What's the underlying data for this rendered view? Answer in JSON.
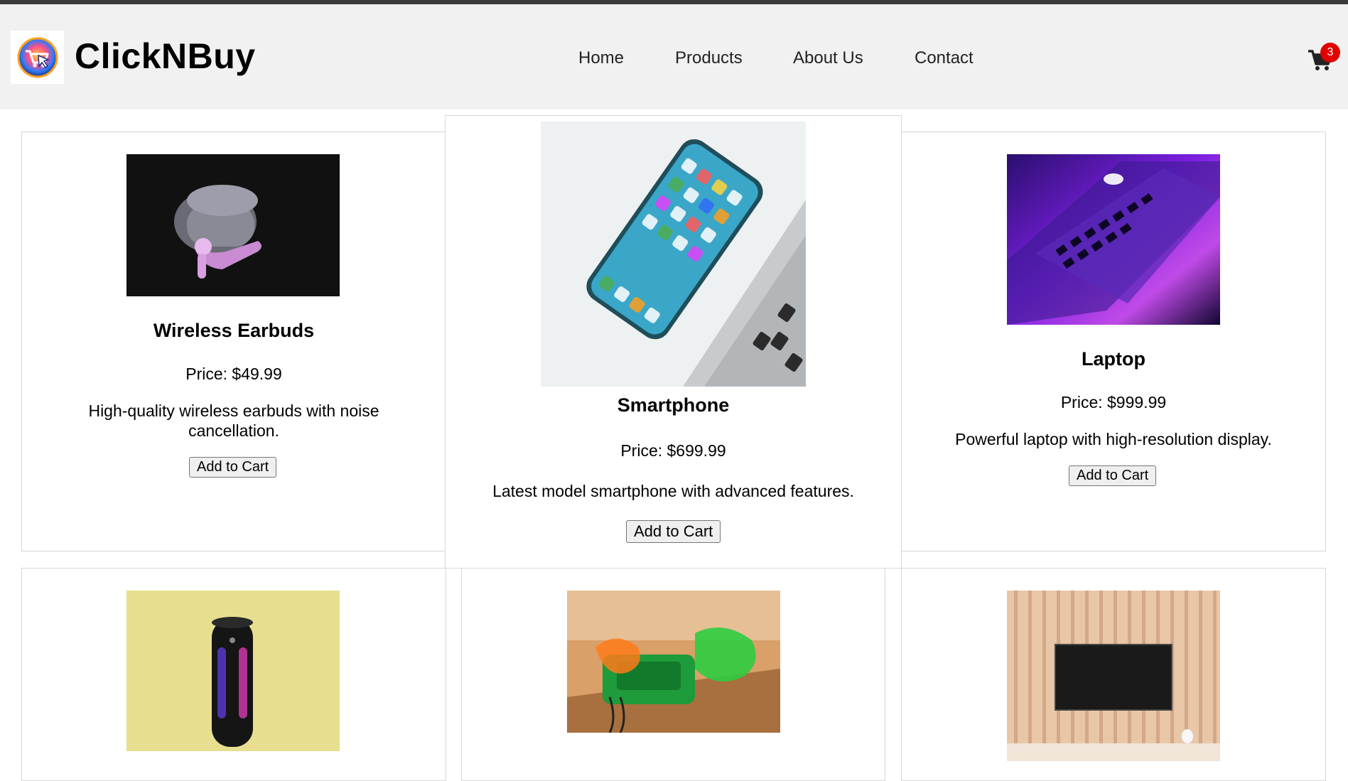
{
  "header": {
    "brand": "ClickNBuy",
    "logo_icon": "shopping-cart-cursor-logo",
    "nav": [
      "Home",
      "Products",
      "About Us",
      "Contact"
    ],
    "cart_icon": "cart-icon",
    "cart_count": "3"
  },
  "products": [
    {
      "name": "Wireless Earbuds",
      "price": "Price: $49.99",
      "description": "High-quality wireless earbuds with noise cancellation.",
      "button": "Add to Cart"
    },
    {
      "name": "Smartphone",
      "price": "Price: $699.99",
      "description": "Latest model smartphone with advanced features.",
      "button": "Add to Cart"
    },
    {
      "name": "Laptop",
      "price": "Price: $999.99",
      "description": "Powerful laptop with high-resolution display.",
      "button": "Add to Cart"
    }
  ],
  "colors": {
    "header_bg": "#f1f1f1",
    "badge": "#e00000"
  }
}
